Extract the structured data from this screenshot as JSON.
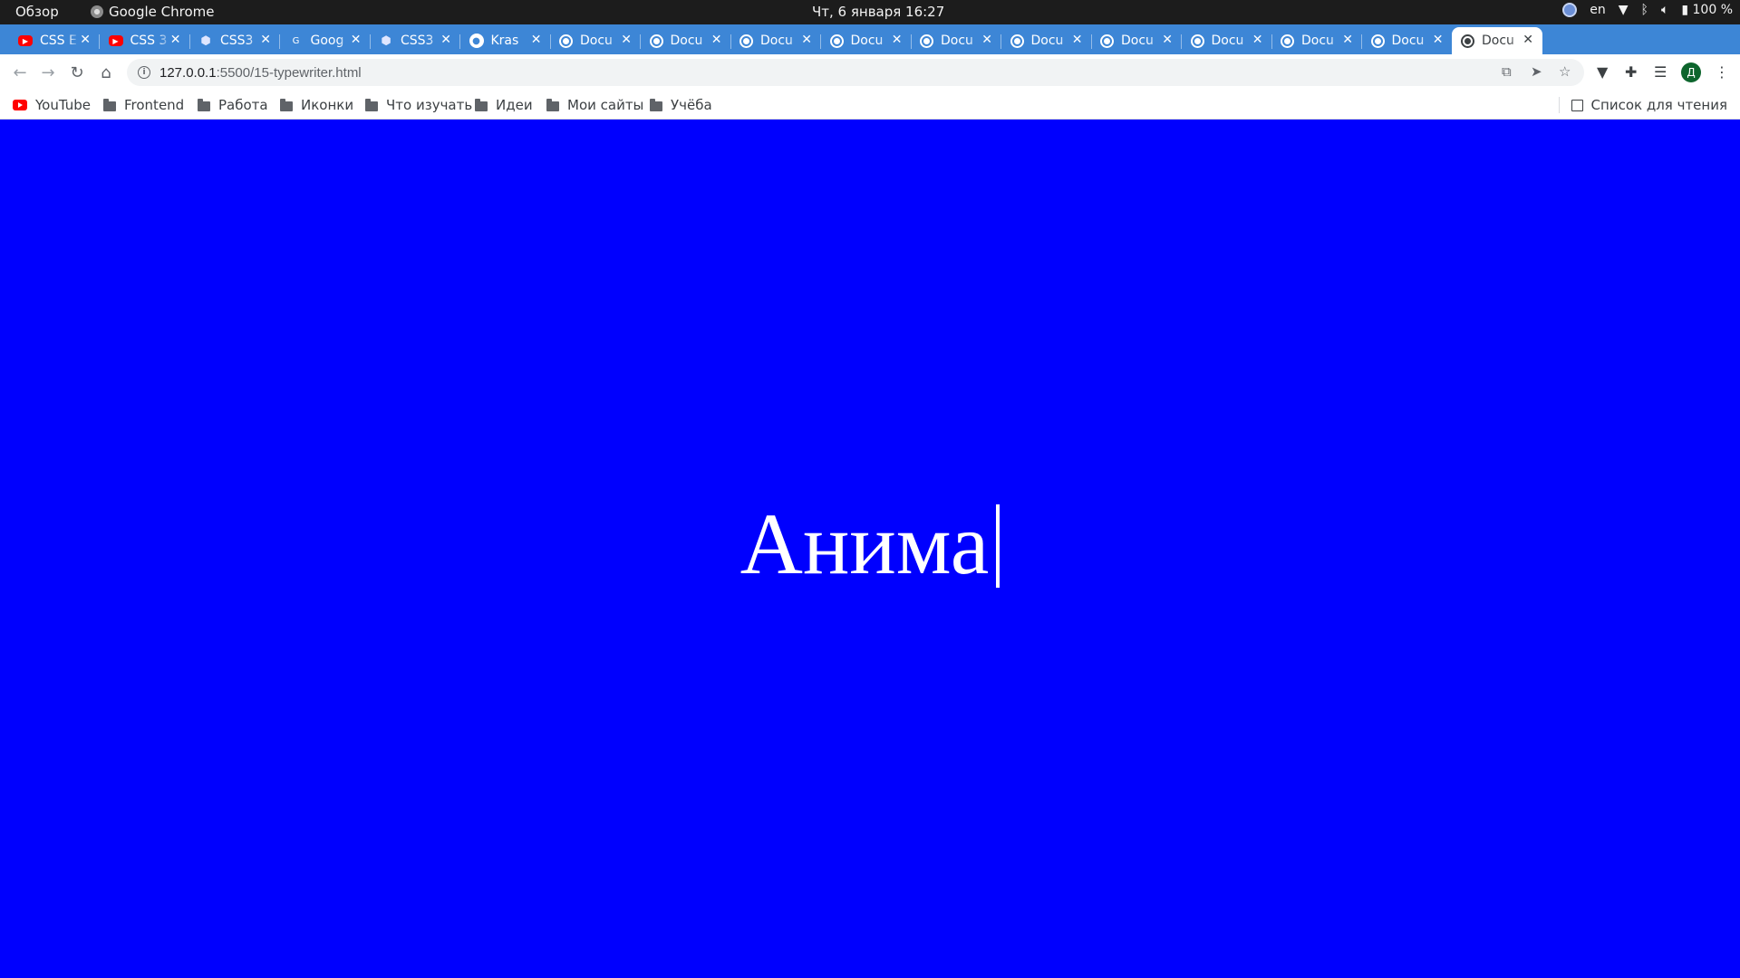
{
  "system_bar": {
    "overview": "Обзор",
    "app_name": "Google Chrome",
    "clock": "Чт, 6 января  16:27",
    "lang": "en",
    "battery": "100 %"
  },
  "tabs": [
    {
      "title": "CSS E",
      "icon": "youtube-icon"
    },
    {
      "title": "CSS 3",
      "icon": "youtube-icon"
    },
    {
      "title": "CSS3",
      "icon": "css3-icon"
    },
    {
      "title": "Goog",
      "icon": "google-translate-icon"
    },
    {
      "title": "CSS3",
      "icon": "css3-icon"
    },
    {
      "title": "Kras",
      "icon": "github-icon"
    },
    {
      "title": "Docu",
      "icon": "globe-icon"
    },
    {
      "title": "Docu",
      "icon": "globe-icon"
    },
    {
      "title": "Docu",
      "icon": "globe-icon"
    },
    {
      "title": "Docu",
      "icon": "globe-icon"
    },
    {
      "title": "Docu",
      "icon": "globe-icon"
    },
    {
      "title": "Docu",
      "icon": "globe-icon"
    },
    {
      "title": "Docu",
      "icon": "globe-icon"
    },
    {
      "title": "Docu",
      "icon": "globe-icon"
    },
    {
      "title": "Docu",
      "icon": "globe-icon"
    },
    {
      "title": "Docu",
      "icon": "globe-icon"
    },
    {
      "title": "Docu",
      "icon": "globe-icon",
      "active": true
    }
  ],
  "address_bar": {
    "host": "127.0.0.1",
    "path": ":5500/15-typewriter.html"
  },
  "bookmarks": {
    "items": [
      {
        "label": "YouTube",
        "icon": "youtube-icon"
      },
      {
        "label": "Frontend",
        "icon": "folder-icon"
      },
      {
        "label": "Работа",
        "icon": "folder-icon"
      },
      {
        "label": "Иконки",
        "icon": "folder-icon"
      },
      {
        "label": "Что изучать",
        "icon": "folder-icon"
      },
      {
        "label": "Идеи",
        "icon": "folder-icon"
      },
      {
        "label": "Мои сайты",
        "icon": "folder-icon"
      },
      {
        "label": "Учёба",
        "icon": "folder-icon"
      }
    ],
    "reading_list": "Список для чтения"
  },
  "page": {
    "typed_text": "Анима",
    "background_color": "#0000fe",
    "text_color": "#ffffff"
  },
  "profile": {
    "initial": "Д"
  }
}
